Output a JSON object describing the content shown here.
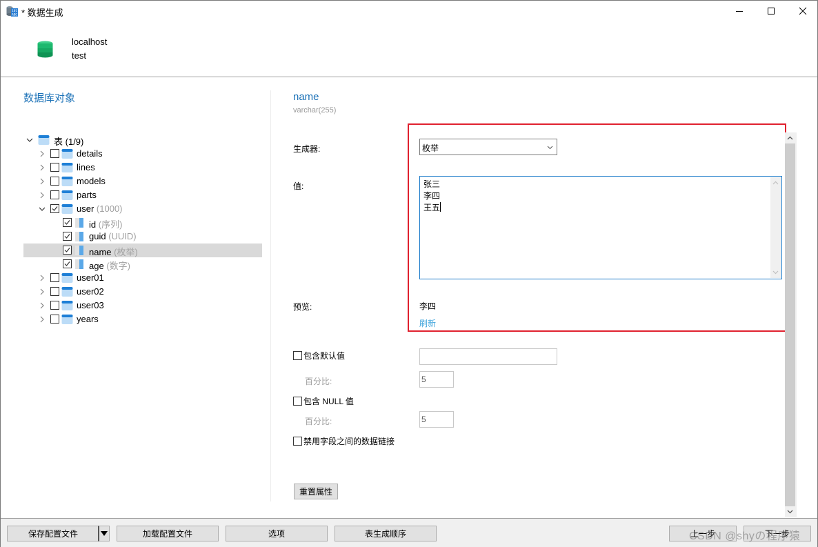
{
  "window": {
    "title": "* 数据生成",
    "controls": {
      "minimize": "minimize",
      "maximize": "maximize",
      "close": "close"
    }
  },
  "connection": {
    "host": "localhost",
    "database": "test"
  },
  "left_panel": {
    "title": "数据库对象",
    "tree": {
      "root": {
        "label": "表",
        "count": "(1/9)",
        "expanded": true
      },
      "tables": [
        {
          "name": "details",
          "checked": false,
          "expanded": false
        },
        {
          "name": "lines",
          "checked": false,
          "expanded": false
        },
        {
          "name": "models",
          "checked": false,
          "expanded": false
        },
        {
          "name": "parts",
          "checked": false,
          "expanded": false
        },
        {
          "name": "user",
          "count": "(1000)",
          "checked": true,
          "expanded": true,
          "columns": [
            {
              "name": "id",
              "generator": "(序列)",
              "checked": true
            },
            {
              "name": "guid",
              "generator": "(UUID)",
              "checked": true
            },
            {
              "name": "name",
              "generator": "(枚举)",
              "checked": true,
              "selected": true
            },
            {
              "name": "age",
              "generator": "(数字)",
              "checked": true
            }
          ]
        },
        {
          "name": "user01",
          "checked": false,
          "expanded": false
        },
        {
          "name": "user02",
          "checked": false,
          "expanded": false
        },
        {
          "name": "user03",
          "checked": false,
          "expanded": false
        },
        {
          "name": "years",
          "checked": false,
          "expanded": false
        }
      ]
    }
  },
  "field": {
    "name": "name",
    "type": "varchar(255)",
    "generator_label": "生成器:",
    "generator_value": "枚举",
    "values_label": "值:",
    "values": [
      "张三",
      "李四",
      "王五"
    ],
    "preview_label": "预览:",
    "preview_value": "李四",
    "refresh_label": "刷新",
    "include_default_label": "包含默认值",
    "include_default_checked": false,
    "default_value": "",
    "default_percent_label": "百分比:",
    "default_percent": "5",
    "include_null_label": "包含 NULL 值",
    "include_null_checked": false,
    "null_percent_label": "百分比:",
    "null_percent": "5",
    "disable_link_label": "禁用字段之间的数据链接",
    "disable_link_checked": false,
    "reset_label": "重置属性"
  },
  "footer": {
    "save_profile": "保存配置文件",
    "load_profile": "加载配置文件",
    "options": "选项",
    "table_order": "表生成顺序",
    "back": "上一步",
    "next": "下一步"
  },
  "watermark": "CSDN @shyの程序猿",
  "colors": {
    "accent": "#1e73b8",
    "highlight_border": "#e0202e",
    "link": "#3fa4dc",
    "focus_border": "#1a7ac9"
  }
}
